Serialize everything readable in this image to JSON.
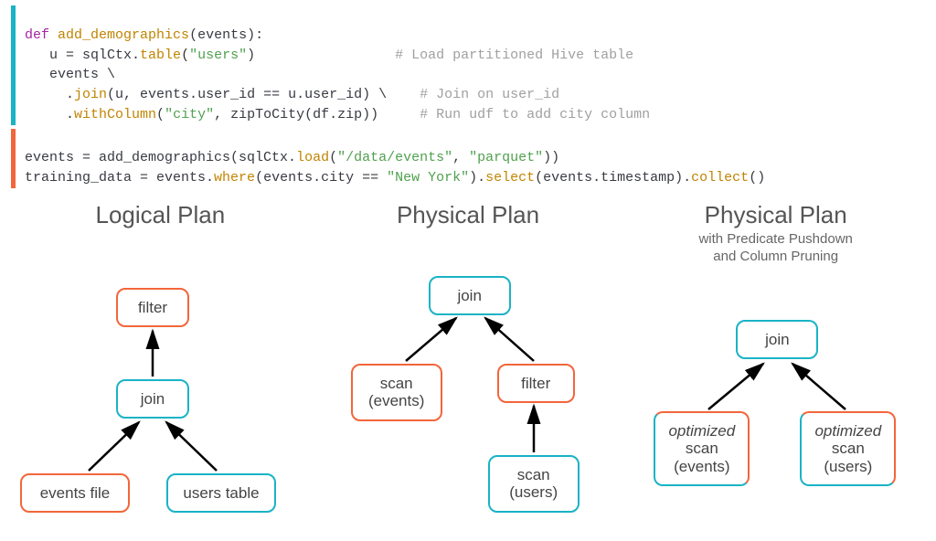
{
  "code": {
    "block1": {
      "l1": {
        "kw": "def",
        "fn": "add_demographics",
        "rest": "(events):"
      },
      "l2": {
        "lhs": "u = sqlCtx.",
        "call": "table",
        "arg": "\"users\"",
        "cparen": ")",
        "cmt": "# Load partitioned Hive table"
      },
      "l3": {
        "txt": "events \\"
      },
      "l4": {
        "pre": ".",
        "call": "join",
        "args": "(u, events.user_id == u.user_id) \\",
        "cmt": "# Join on user_id"
      },
      "l5": {
        "pre": ".",
        "call": "withColumn",
        "args_open": "(",
        "str1": "\"city\"",
        "sep": ", zipToCity(df.zip))",
        "cmt": "# Run udf to add city column"
      }
    },
    "block2": {
      "l1": {
        "a": "events = add_demographics(sqlCtx.",
        "call": "load",
        "args_open": "(",
        "str1": "\"/data/events\"",
        "sep": ", ",
        "str2": "\"parquet\"",
        "close": "))"
      },
      "l2": {
        "a": "training_data = events.",
        "call1": "where",
        "args1": "(events.city == ",
        "str": "\"New York\"",
        "mid": ").",
        "call2": "select",
        "args2": "(events.timestamp).",
        "call3": "collect",
        "end": "()"
      }
    }
  },
  "colors": {
    "cyan": "#19b3c6",
    "orange": "#f2663b"
  },
  "plans": {
    "logical": {
      "title": "Logical Plan",
      "nodes": {
        "filter": "filter",
        "join": "join",
        "events": "events file",
        "users": "users table"
      }
    },
    "physical": {
      "title": "Physical Plan",
      "nodes": {
        "join": "join",
        "scan_events_l1": "scan",
        "scan_events_l2": "(events)",
        "filter": "filter",
        "scan_users_l1": "scan",
        "scan_users_l2": "(users)"
      }
    },
    "optimized": {
      "title": "Physical Plan",
      "sub": "with Predicate Pushdown\nand Column Pruning",
      "nodes": {
        "join": "join",
        "opt": "optimized",
        "scan_ev_l1": "scan",
        "scan_ev_l2": "(events)",
        "scan_us_l1": "scan",
        "scan_us_l2": "(users)"
      }
    }
  }
}
